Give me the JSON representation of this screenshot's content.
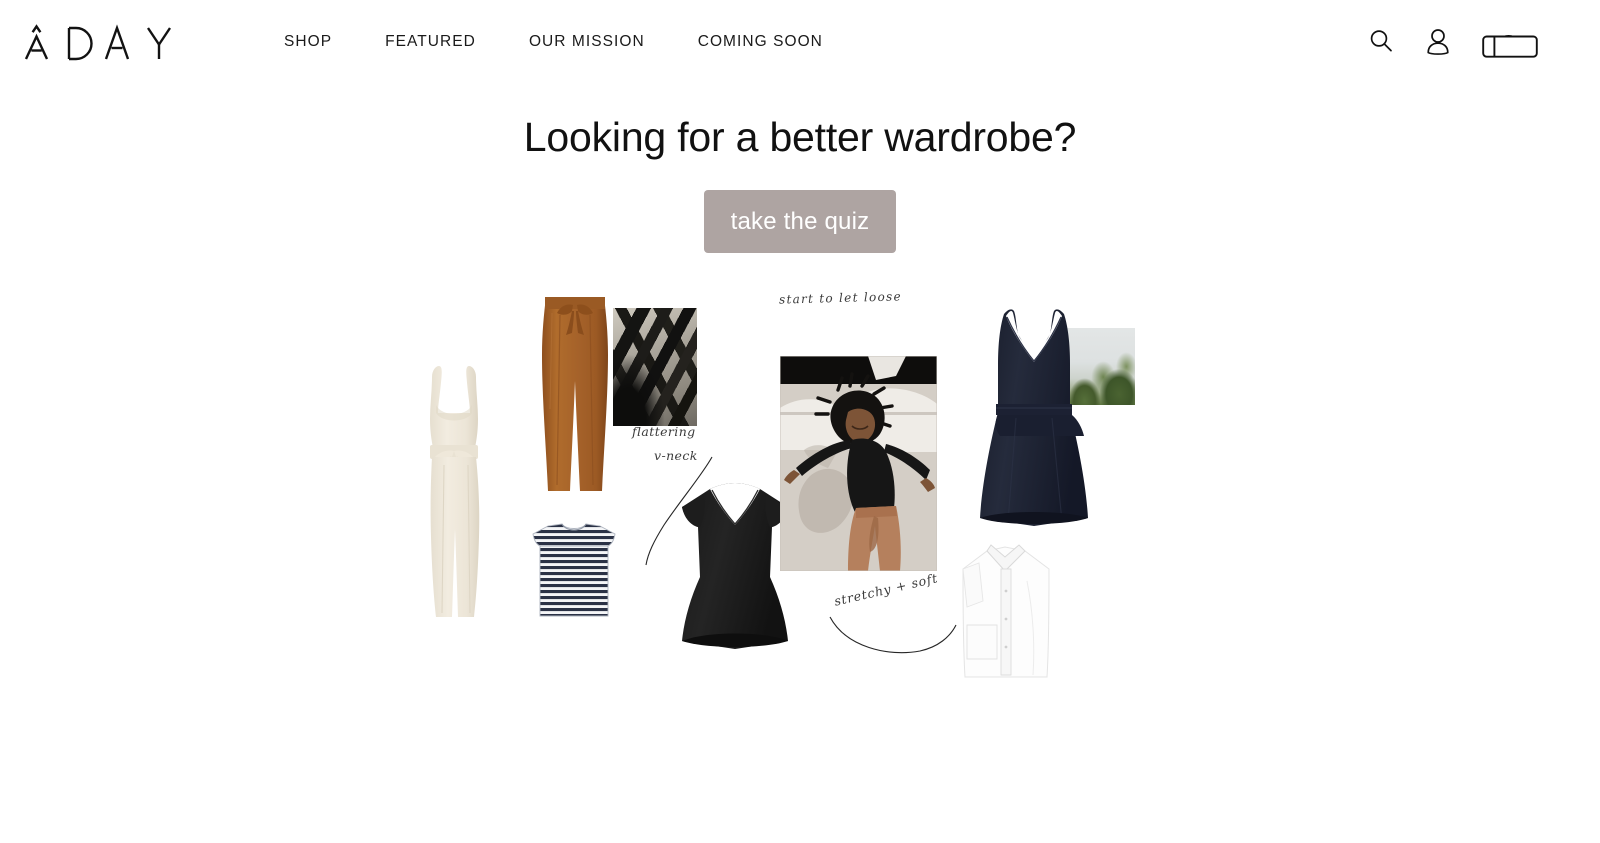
{
  "site": {
    "brand": "ADAY",
    "brand_letters": [
      "A",
      "D",
      "A",
      "Y"
    ]
  },
  "header": {
    "nav": [
      {
        "label": "SHOP",
        "name": "nav-shop"
      },
      {
        "label": "FEATURED",
        "name": "nav-featured"
      },
      {
        "label": "OUR MISSION",
        "name": "nav-our-mission"
      },
      {
        "label": "COMING SOON",
        "name": "nav-coming-soon"
      }
    ],
    "icons": [
      {
        "name": "search-icon",
        "label": "Search"
      },
      {
        "name": "account-icon",
        "label": "Account"
      },
      {
        "name": "bag-icon",
        "label": "Bag"
      }
    ]
  },
  "hero": {
    "title": "Looking for a better wardrobe?",
    "cta_label": "take the quiz",
    "cta_color": "#aea4a2",
    "cta_text_color": "#ffffff"
  },
  "collage": {
    "annotations": {
      "flattering": "flattering",
      "vneck": "v-neck",
      "let_loose": "start to let loose",
      "stretchy_soft": "stretchy + soft"
    },
    "items": [
      {
        "name": "product-jumpsuit-cream",
        "alt": "Cream sleeveless tie-waist jumpsuit",
        "color": "#efe9dc"
      },
      {
        "name": "product-pants-rust",
        "alt": "Rust brown drawstring tie pants",
        "color": "#a5622a"
      },
      {
        "name": "photo-agave-leaves",
        "alt": "Black and white photo of agave leaves"
      },
      {
        "name": "product-striped-tee",
        "alt": "Navy and white striped folded tee",
        "color": "#2b3246"
      },
      {
        "name": "product-vneck-top-black",
        "alt": "Black long sleeve v-neck top",
        "color": "#1b1b1b"
      },
      {
        "name": "photo-model-dancing",
        "alt": "Model in black top and clay pants against sunlit wall"
      },
      {
        "name": "product-navy-dress",
        "alt": "Navy v-neck belted slip dress",
        "color": "#1c2132"
      },
      {
        "name": "photo-green-trees",
        "alt": "Photo of green trees against pale sky"
      },
      {
        "name": "product-white-shirt",
        "alt": "White collared button-up shirt",
        "color": "#fbfbfb"
      }
    ]
  }
}
